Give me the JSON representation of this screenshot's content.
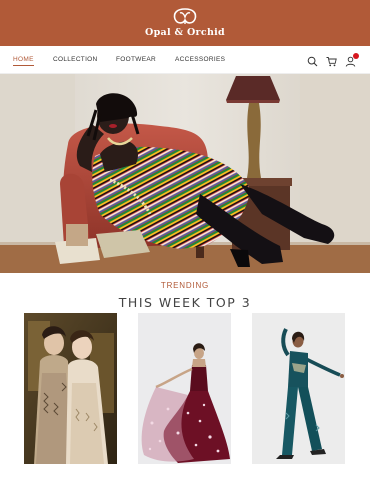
{
  "brand": {
    "name": "Opal & Orchid",
    "logo_icon": "opal-orchid-logo-icon",
    "color": "#b15a38"
  },
  "nav": {
    "items": [
      {
        "label": "HOME",
        "active": true
      },
      {
        "label": "COLLECTION",
        "active": false
      },
      {
        "label": "FOOTWEAR",
        "active": false
      },
      {
        "label": "ACCESSORIES",
        "active": false
      }
    ],
    "icons": [
      "search-icon",
      "cart-icon",
      "user-icon"
    ]
  },
  "hero": {
    "image": "hero-fashion-photo"
  },
  "trending": {
    "kicker": "TRENDING",
    "title": "THIS WEEK TOP 3",
    "products": [
      {
        "image": "two-women-gowns-photo"
      },
      {
        "image": "burgundy-gown-photo"
      },
      {
        "image": "teal-jumpsuit-photo"
      }
    ]
  }
}
